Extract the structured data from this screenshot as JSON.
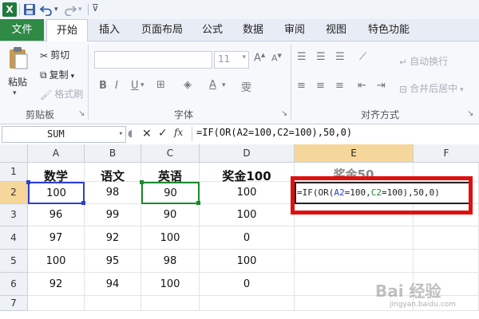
{
  "quick_access": {
    "app_icon_letter": "X"
  },
  "tabs": [
    "文件",
    "开始",
    "插入",
    "页面布局",
    "公式",
    "数据",
    "审阅",
    "视图",
    "特色功能"
  ],
  "ribbon": {
    "paste_label": "粘贴",
    "cut_label": "剪切",
    "copy_label": "复制",
    "format_painter_label": "格式刷",
    "clipboard_group": "剪贴板",
    "font_size": "11",
    "font_group": "字体",
    "wrap_text_label": "自动换行",
    "merge_center_label": "合并后居中",
    "alignment_group": "对齐方式"
  },
  "formula_bar": {
    "name_box": "SUM",
    "formula": "=IF(OR(A2=100,C2=100),50,0)"
  },
  "columns": [
    "A",
    "B",
    "C",
    "D",
    "E",
    "F"
  ],
  "rows": [
    "1",
    "2",
    "3",
    "4",
    "5",
    "6",
    "7"
  ],
  "cells": [
    [
      "数学",
      "语文",
      "英语",
      "奖金100",
      "奖金50",
      ""
    ],
    [
      "100",
      "98",
      "90",
      "100",
      "",
      ""
    ],
    [
      "96",
      "99",
      "90",
      "100",
      "",
      ""
    ],
    [
      "97",
      "92",
      "100",
      "0",
      "",
      ""
    ],
    [
      "100",
      "95",
      "98",
      "100",
      "",
      ""
    ],
    [
      "92",
      "94",
      "100",
      "0",
      "",
      ""
    ],
    [
      "",
      "",
      "",
      "",
      "",
      ""
    ]
  ],
  "edit_cell": {
    "p1": "=IF(OR(",
    "ref1": "A2",
    "p2": "=100,",
    "ref2": "C2",
    "p3": "=100),50,0)"
  },
  "watermark": "Bai 经验",
  "watermark_url": "jingyan.baidu.com",
  "colors": {
    "ref1": "#2b3fcf",
    "ref2": "#1a8a2c",
    "highlight": "#e01010",
    "file_tab": "#2e8a45"
  }
}
